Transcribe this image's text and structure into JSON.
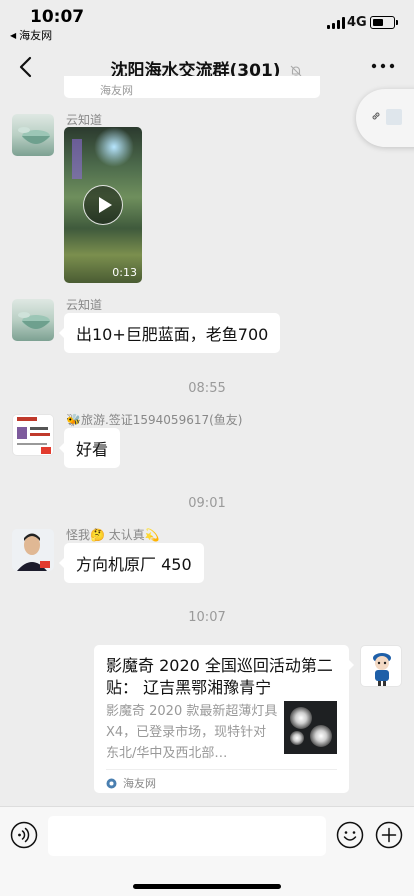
{
  "status_bar": {
    "time": "10:07",
    "back_app": "海友网",
    "network": "4G",
    "battery_level": 0.55
  },
  "nav": {
    "title": "沈阳海水交流群(301)",
    "back_icon": "chevron-left-icon",
    "mute_icon": "bell-off-icon",
    "more_icon": "ellipsis-icon"
  },
  "top_cut": {
    "text": "海友网"
  },
  "float_button": {
    "icon": "link-icon"
  },
  "messages": [
    {
      "type": "video",
      "sender": "云知道",
      "duration": "0:13"
    },
    {
      "type": "text",
      "sender": "云知道",
      "text": "出10+巨肥蓝面，老鱼700"
    },
    {
      "type": "time",
      "text": "08:55"
    },
    {
      "type": "text",
      "sender": "🐝旅游.签证1594059617(鱼友)",
      "text": "好看"
    },
    {
      "type": "time",
      "text": "09:01"
    },
    {
      "type": "text",
      "sender": "怪我🤔 太认真💫",
      "text": "方向机原厂 450"
    },
    {
      "type": "time",
      "text": "10:07"
    },
    {
      "type": "link",
      "title": "影魔奇 2020 全国巡回活动第二贴： 辽吉黑鄂湘豫青宁",
      "description": "影魔奇 2020 款最新超薄灯具 X4，已登录市场，现特针对东北/华中及西北部…",
      "source": "海友网"
    }
  ],
  "input_bar": {
    "placeholder": "",
    "voice_icon": "voice-icon",
    "emoji_icon": "emoji-icon",
    "plus_icon": "plus-circle-icon"
  }
}
